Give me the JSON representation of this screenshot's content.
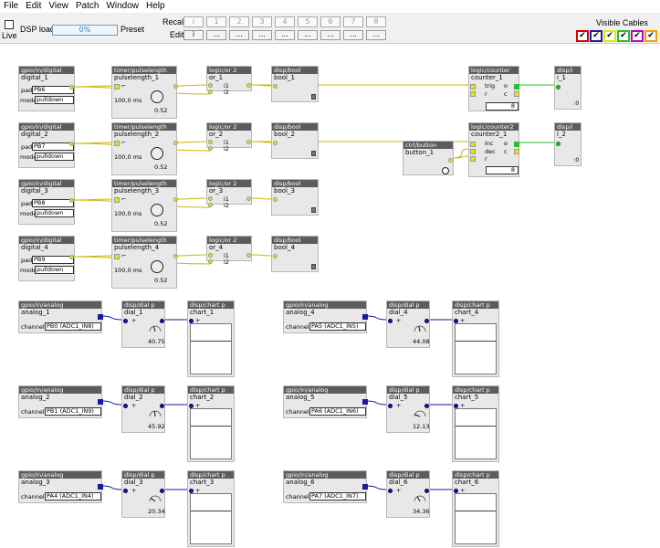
{
  "menu": {
    "items": [
      "File",
      "Edit",
      "View",
      "Patch",
      "Window",
      "Help"
    ]
  },
  "toolbar": {
    "live_label": "Live",
    "dsp_label": "DSP load",
    "dsp_value": "0%",
    "preset_label": "Preset",
    "recall_label": "Recall",
    "edit_label": "Edit",
    "recall_buttons": [
      "i",
      "1",
      "2",
      "3",
      "4",
      "5",
      "6",
      "7",
      "8"
    ],
    "edit_buttons": [
      "i",
      "...",
      "...",
      "...",
      "...",
      "...",
      "...",
      "...",
      "..."
    ],
    "visible_cables_label": "Visible Cables",
    "cable_colors": [
      "#d60000",
      "#1a1a9e",
      "#e6e600",
      "#2bbf2b",
      "#c000c0",
      "#ff9900"
    ],
    "cable_checks": [
      "✔",
      "✔",
      "✔",
      "✔",
      "✔",
      "✔"
    ]
  },
  "labels": {
    "pad": "pad",
    "mode": "mode",
    "channel": "channel",
    "trig": "trig",
    "r": "r",
    "o": "o",
    "c": "c",
    "inc": "inc",
    "dec": "dec",
    "i1": "i1",
    "i2": "i2",
    "plus": "+",
    "step": "┘",
    "sig": "⌐"
  },
  "digital": [
    {
      "title": "gpio/in/digital",
      "name": "digital_1",
      "pad": "PB6",
      "mode": "pulldown"
    },
    {
      "title": "gpio/in/digital",
      "name": "digital_2",
      "pad": "PB7",
      "mode": "pulldown"
    },
    {
      "title": "gpio/in/digital",
      "name": "digital_3",
      "pad": "PB8",
      "mode": "pulldown"
    },
    {
      "title": "gpio/in/digital",
      "name": "digital_4",
      "pad": "PB9",
      "mode": "pulldown"
    }
  ],
  "pulse": [
    {
      "title": "timer/pulselength",
      "name": "pulselength_1",
      "time": "100,0 ms",
      "knob": "0.52"
    },
    {
      "title": "timer/pulselength",
      "name": "pulselength_2",
      "time": "100,0 ms",
      "knob": "0.52"
    },
    {
      "title": "timer/pulselength",
      "name": "pulselength_3",
      "time": "100,0 ms",
      "knob": "0.52"
    },
    {
      "title": "timer/pulselength",
      "name": "pulselength_4",
      "time": "100,0 ms",
      "knob": "0.52"
    }
  ],
  "ors": [
    {
      "title": "logic/or 2",
      "name": "or_1"
    },
    {
      "title": "logic/or 2",
      "name": "or_2"
    },
    {
      "title": "logic/or 2",
      "name": "or_3"
    },
    {
      "title": "logic/or 2",
      "name": "or_4"
    }
  ],
  "bools": [
    {
      "title": "disp/bool",
      "name": "bool_1"
    },
    {
      "title": "disp/bool",
      "name": "bool_2"
    },
    {
      "title": "disp/bool",
      "name": "bool_3"
    },
    {
      "title": "disp/bool",
      "name": "bool_4"
    }
  ],
  "counter1": {
    "title": "logic/counter",
    "name": "counter_1",
    "value": "8"
  },
  "counter2": {
    "title": "logic/counter2",
    "name": "counter2_1",
    "value": "8"
  },
  "button": {
    "title": "ctrl/button",
    "name": "button_1"
  },
  "disp_i": [
    {
      "title": "disp/i",
      "name": "i_1",
      "value": ":0"
    },
    {
      "title": "disp/i",
      "name": "i_2",
      "value": ":0"
    }
  ],
  "analog": [
    {
      "title": "gpio/in/analog",
      "name": "analog_1",
      "channel": "PB0 (ADC1_IN8)"
    },
    {
      "title": "gpio/in/analog",
      "name": "analog_2",
      "channel": "PB1 (ADC1_IN9)"
    },
    {
      "title": "gpio/in/analog",
      "name": "analog_3",
      "channel": "PA4 (ADC1_IN4)"
    },
    {
      "title": "gpio/in/analog",
      "name": "analog_4",
      "channel": "PA5 (ADC1_IN5)"
    },
    {
      "title": "gpio/in/analog",
      "name": "analog_5",
      "channel": "PA6 (ADC1_IN6)"
    },
    {
      "title": "gpio/in/analog",
      "name": "analog_6",
      "channel": "PA7 (ADC1_IN7)"
    }
  ],
  "dials": [
    {
      "title": "disp/dial p",
      "name": "dial_1",
      "value": "40.75",
      "level": 0.4075
    },
    {
      "title": "disp/dial p",
      "name": "dial_2",
      "value": "45.92",
      "level": 0.4592
    },
    {
      "title": "disp/dial p",
      "name": "dial_3",
      "value": "20.34",
      "level": 0.2034
    },
    {
      "title": "disp/dial p",
      "name": "dial_4",
      "value": "44.08",
      "level": 0.4408
    },
    {
      "title": "disp/dial p",
      "name": "dial_5",
      "value": "12.13",
      "level": 0.1213
    },
    {
      "title": "disp/dial p",
      "name": "dial_6",
      "value": "34.36",
      "level": 0.3436
    }
  ],
  "charts": [
    {
      "title": "disp/chart p",
      "name": "chart_1"
    },
    {
      "title": "disp/chart p",
      "name": "chart_2"
    },
    {
      "title": "disp/chart p",
      "name": "chart_3"
    },
    {
      "title": "disp/chart p",
      "name": "chart_4"
    },
    {
      "title": "disp/chart p",
      "name": "chart_5"
    },
    {
      "title": "disp/chart p",
      "name": "chart_6"
    }
  ]
}
